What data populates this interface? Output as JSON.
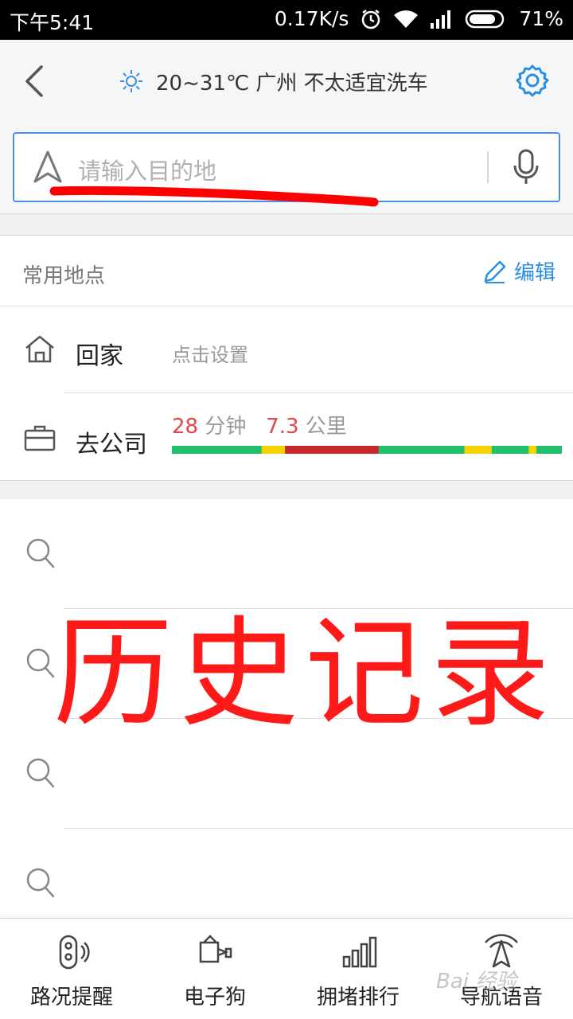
{
  "status_bar": {
    "time": "下午5:41",
    "net_speed": "0.17K/s",
    "battery": "71%"
  },
  "header": {
    "weather": "20~31℃ 广州 不太适宜洗车",
    "search_placeholder": "请输入目的地"
  },
  "frequent_places": {
    "title": "常用地点",
    "edit_label": "编辑",
    "home": {
      "label": "回家",
      "hint": "点击设置"
    },
    "work": {
      "label": "去公司",
      "time_value": "28",
      "time_unit": "分钟",
      "distance_value": "7.3",
      "distance_unit": "公里",
      "traffic_segments": [
        {
          "state": "clear",
          "color": "#1fbf6b",
          "fraction": 0.23
        },
        {
          "state": "slow",
          "color": "#f5d300",
          "fraction": 0.06
        },
        {
          "state": "jam",
          "color": "#c8282a",
          "fraction": 0.24
        },
        {
          "state": "clear",
          "color": "#1fbf6b",
          "fraction": 0.22
        },
        {
          "state": "slow",
          "color": "#f5d300",
          "fraction": 0.07
        },
        {
          "state": "clear",
          "color": "#1fbf6b",
          "fraction": 0.095
        },
        {
          "state": "slow",
          "color": "#f5d300",
          "fraction": 0.02
        },
        {
          "state": "clear",
          "color": "#1fbf6b",
          "fraction": 0.065
        }
      ]
    }
  },
  "history": {
    "annotation": "历史记录",
    "annotation_color": "#ff1a1a",
    "rows": 4
  },
  "tabs": [
    {
      "label": "路况提醒",
      "icon": "traffic-alert-icon"
    },
    {
      "label": "电子狗",
      "icon": "camera-dog-icon"
    },
    {
      "label": "拥堵排行",
      "icon": "bar-chart-icon"
    },
    {
      "label": "导航语音",
      "icon": "nav-voice-icon"
    }
  ],
  "watermark": "Bai 经验",
  "colors": {
    "accent": "#2a8fe3",
    "alert": "#e0474c"
  }
}
